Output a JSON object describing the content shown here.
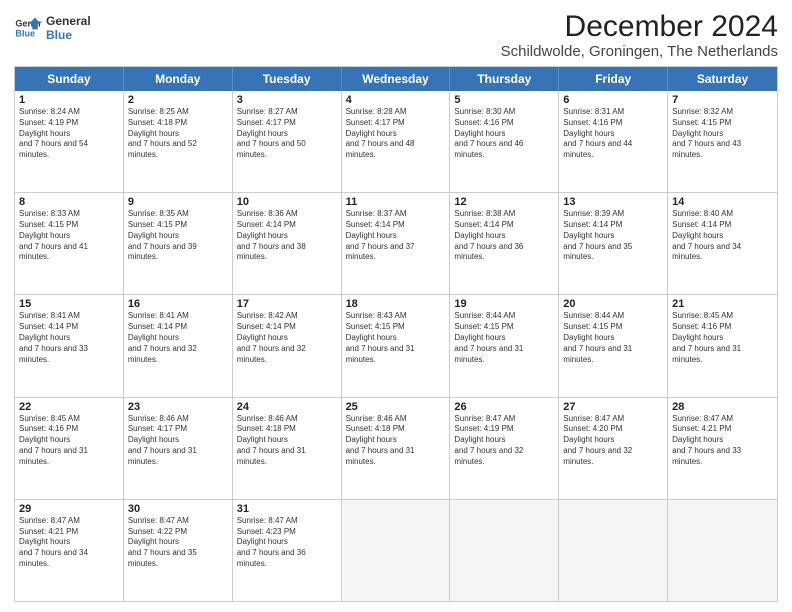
{
  "logo": {
    "line1": "General",
    "line2": "Blue"
  },
  "title": "December 2024",
  "subtitle": "Schildwolde, Groningen, The Netherlands",
  "days": [
    "Sunday",
    "Monday",
    "Tuesday",
    "Wednesday",
    "Thursday",
    "Friday",
    "Saturday"
  ],
  "weeks": [
    [
      {
        "day": "1",
        "rise": "8:24 AM",
        "set": "4:19 PM",
        "daylight": "7 hours and 54 minutes."
      },
      {
        "day": "2",
        "rise": "8:25 AM",
        "set": "4:18 PM",
        "daylight": "7 hours and 52 minutes."
      },
      {
        "day": "3",
        "rise": "8:27 AM",
        "set": "4:17 PM",
        "daylight": "7 hours and 50 minutes."
      },
      {
        "day": "4",
        "rise": "8:28 AM",
        "set": "4:17 PM",
        "daylight": "7 hours and 48 minutes."
      },
      {
        "day": "5",
        "rise": "8:30 AM",
        "set": "4:16 PM",
        "daylight": "7 hours and 46 minutes."
      },
      {
        "day": "6",
        "rise": "8:31 AM",
        "set": "4:16 PM",
        "daylight": "7 hours and 44 minutes."
      },
      {
        "day": "7",
        "rise": "8:32 AM",
        "set": "4:15 PM",
        "daylight": "7 hours and 43 minutes."
      }
    ],
    [
      {
        "day": "8",
        "rise": "8:33 AM",
        "set": "4:15 PM",
        "daylight": "7 hours and 41 minutes."
      },
      {
        "day": "9",
        "rise": "8:35 AM",
        "set": "4:15 PM",
        "daylight": "7 hours and 39 minutes."
      },
      {
        "day": "10",
        "rise": "8:36 AM",
        "set": "4:14 PM",
        "daylight": "7 hours and 38 minutes."
      },
      {
        "day": "11",
        "rise": "8:37 AM",
        "set": "4:14 PM",
        "daylight": "7 hours and 37 minutes."
      },
      {
        "day": "12",
        "rise": "8:38 AM",
        "set": "4:14 PM",
        "daylight": "7 hours and 36 minutes."
      },
      {
        "day": "13",
        "rise": "8:39 AM",
        "set": "4:14 PM",
        "daylight": "7 hours and 35 minutes."
      },
      {
        "day": "14",
        "rise": "8:40 AM",
        "set": "4:14 PM",
        "daylight": "7 hours and 34 minutes."
      }
    ],
    [
      {
        "day": "15",
        "rise": "8:41 AM",
        "set": "4:14 PM",
        "daylight": "7 hours and 33 minutes."
      },
      {
        "day": "16",
        "rise": "8:41 AM",
        "set": "4:14 PM",
        "daylight": "7 hours and 32 minutes."
      },
      {
        "day": "17",
        "rise": "8:42 AM",
        "set": "4:14 PM",
        "daylight": "7 hours and 32 minutes."
      },
      {
        "day": "18",
        "rise": "8:43 AM",
        "set": "4:15 PM",
        "daylight": "7 hours and 31 minutes."
      },
      {
        "day": "19",
        "rise": "8:44 AM",
        "set": "4:15 PM",
        "daylight": "7 hours and 31 minutes."
      },
      {
        "day": "20",
        "rise": "8:44 AM",
        "set": "4:15 PM",
        "daylight": "7 hours and 31 minutes."
      },
      {
        "day": "21",
        "rise": "8:45 AM",
        "set": "4:16 PM",
        "daylight": "7 hours and 31 minutes."
      }
    ],
    [
      {
        "day": "22",
        "rise": "8:45 AM",
        "set": "4:16 PM",
        "daylight": "7 hours and 31 minutes."
      },
      {
        "day": "23",
        "rise": "8:46 AM",
        "set": "4:17 PM",
        "daylight": "7 hours and 31 minutes."
      },
      {
        "day": "24",
        "rise": "8:46 AM",
        "set": "4:18 PM",
        "daylight": "7 hours and 31 minutes."
      },
      {
        "day": "25",
        "rise": "8:46 AM",
        "set": "4:18 PM",
        "daylight": "7 hours and 31 minutes."
      },
      {
        "day": "26",
        "rise": "8:47 AM",
        "set": "4:19 PM",
        "daylight": "7 hours and 32 minutes."
      },
      {
        "day": "27",
        "rise": "8:47 AM",
        "set": "4:20 PM",
        "daylight": "7 hours and 32 minutes."
      },
      {
        "day": "28",
        "rise": "8:47 AM",
        "set": "4:21 PM",
        "daylight": "7 hours and 33 minutes."
      }
    ],
    [
      {
        "day": "29",
        "rise": "8:47 AM",
        "set": "4:21 PM",
        "daylight": "7 hours and 34 minutes."
      },
      {
        "day": "30",
        "rise": "8:47 AM",
        "set": "4:22 PM",
        "daylight": "7 hours and 35 minutes."
      },
      {
        "day": "31",
        "rise": "8:47 AM",
        "set": "4:23 PM",
        "daylight": "7 hours and 36 minutes."
      },
      null,
      null,
      null,
      null
    ]
  ]
}
